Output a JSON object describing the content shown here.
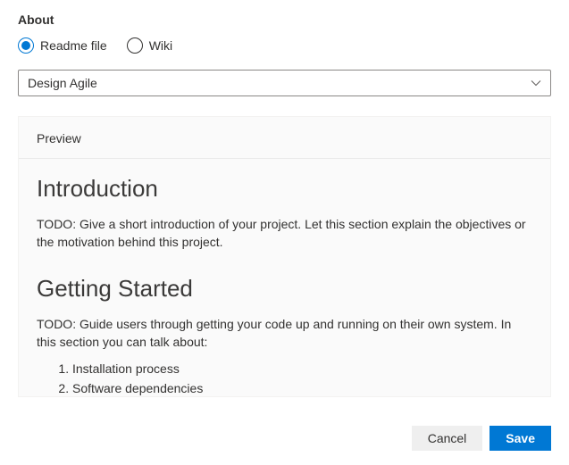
{
  "section": {
    "label": "About"
  },
  "radio": {
    "options": [
      {
        "label": "Readme file",
        "checked": true
      },
      {
        "label": "Wiki",
        "checked": false
      }
    ]
  },
  "dropdown": {
    "value": "Design Agile"
  },
  "preview": {
    "tab_label": "Preview",
    "intro_heading": "Introduction",
    "intro_body": "TODO: Give a short introduction of your project. Let this section explain the objectives or the motivation behind this project.",
    "started_heading": "Getting Started",
    "started_body": "TODO: Guide users through getting your code up and running on their own system. In this section you can talk about:",
    "started_items": [
      "Installation process",
      "Software dependencies"
    ]
  },
  "footer": {
    "cancel_label": "Cancel",
    "save_label": "Save"
  }
}
